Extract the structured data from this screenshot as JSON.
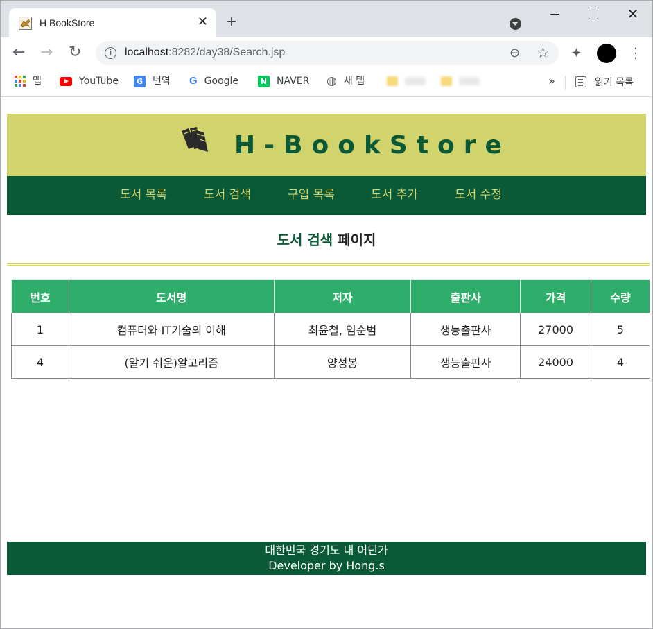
{
  "browser": {
    "tab_title": "H BookStore",
    "tab_close": "✕",
    "new_tab": "+",
    "url_host": "localhost",
    "url_rest": ":8282/day38/Search.jsp",
    "bookmarks": [
      {
        "label": "앱",
        "icon": "apps-grid-icon"
      },
      {
        "label": "YouTube",
        "icon": "youtube-icon"
      },
      {
        "label": "번역",
        "icon": "translate-icon"
      },
      {
        "label": "Google",
        "icon": "google-icon"
      },
      {
        "label": "NAVER",
        "icon": "naver-icon"
      },
      {
        "label": "새 탭",
        "icon": "globe-icon"
      }
    ],
    "bookmarks_more": "»",
    "reading_list": "읽기 목록",
    "icons": {
      "back": "←",
      "forward": "→",
      "reload": "↻",
      "info": "i",
      "zoom": "⊖",
      "star": "☆",
      "extension": "✦",
      "menu": "⋮",
      "google_g": "G",
      "translate_g": "G",
      "naver_n": "N",
      "globe": "◍",
      "close_x": "✕"
    }
  },
  "header": {
    "brand": "H-BookStore",
    "brand_color": "#0b5a37",
    "banner_color": "#d1d36c"
  },
  "nav": {
    "items": [
      "도서 목록",
      "도서 검색",
      "구입 목록",
      "도서 추가",
      "도서 수정"
    ]
  },
  "page": {
    "heading_highlight": "도서 검색",
    "heading_rest": "페이지"
  },
  "table": {
    "headers": [
      "번호",
      "도서명",
      "저자",
      "출판사",
      "가격",
      "수량"
    ],
    "rows": [
      [
        "1",
        "컴퓨터와 IT기술의 이해",
        "최윤철, 임순범",
        "생능출판사",
        "27000",
        "5"
      ],
      [
        "4",
        "(알기 쉬운)알고리즘",
        "양성봉",
        "생능출판사",
        "24000",
        "4"
      ]
    ],
    "header_color": "#2eae6a"
  },
  "footer": {
    "line1": "대한민국 경기도 내 어딘가",
    "line2": "Developer by Hong.s"
  }
}
